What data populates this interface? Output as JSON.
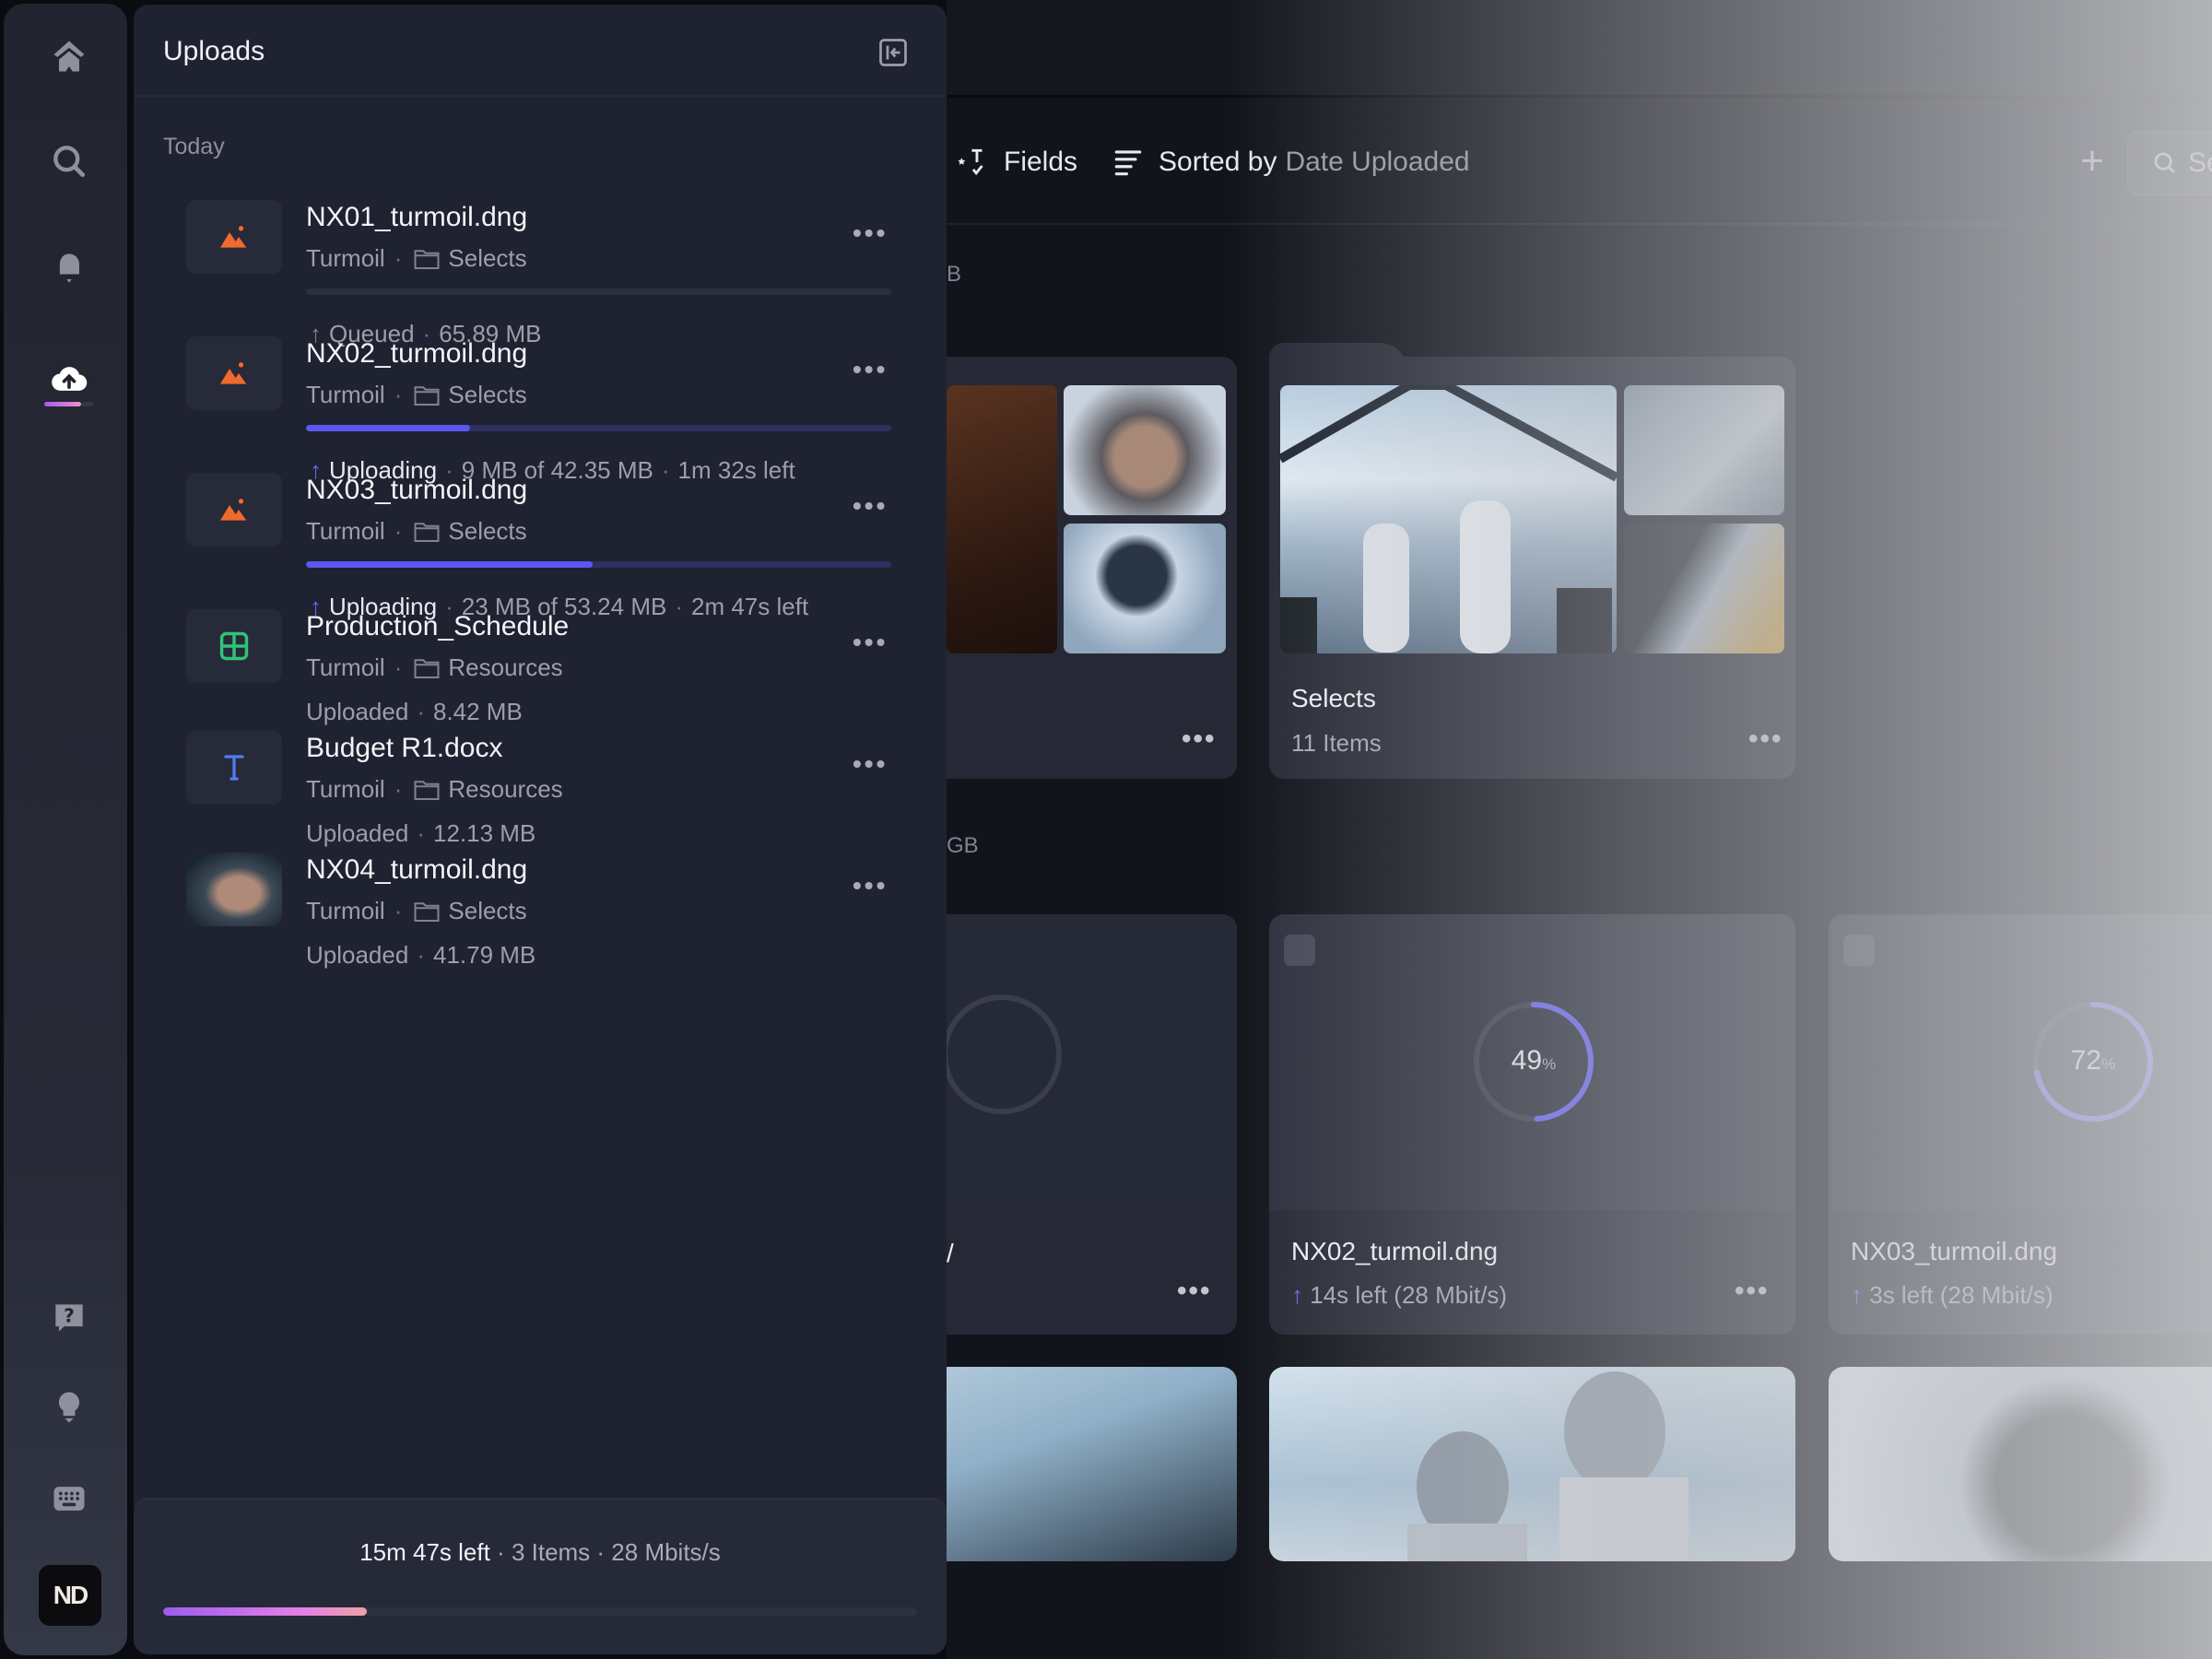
{
  "rail": {
    "items": [
      "home",
      "search",
      "notifications",
      "uploads"
    ],
    "bottom": [
      "help",
      "tips",
      "keyboard-shortcuts"
    ],
    "avatar_initials": "ND",
    "upload_progress": 0.74
  },
  "uploads": {
    "title": "Uploads",
    "group": "Today",
    "items": [
      {
        "name": "NX01_turmoil.dng",
        "project": "Turmoil",
        "folder": "Selects",
        "type": "image",
        "state": "Queued",
        "detail": "65.89 MB",
        "progress": 0
      },
      {
        "name": "NX02_turmoil.dng",
        "project": "Turmoil",
        "folder": "Selects",
        "type": "image",
        "state": "Uploading",
        "detail": "9 MB of 42.35 MB",
        "eta": "1m 32s left",
        "progress": 0.28
      },
      {
        "name": "NX03_turmoil.dng",
        "project": "Turmoil",
        "folder": "Selects",
        "type": "image",
        "state": "Uploading",
        "detail": "23 MB of 53.24 MB",
        "eta": "2m 47s left",
        "progress": 0.49
      },
      {
        "name": "Production_Schedule",
        "project": "Turmoil",
        "folder": "Resources",
        "type": "spreadsheet",
        "state": "Uploaded",
        "detail": "8.42 MB"
      },
      {
        "name": "Budget R1.docx",
        "project": "Turmoil",
        "folder": "Resources",
        "type": "document",
        "state": "Uploaded",
        "detail": "12.13 MB"
      },
      {
        "name": "NX04_turmoil.dng",
        "project": "Turmoil",
        "folder": "Selects",
        "type": "photo",
        "state": "Uploaded",
        "detail": "41.79 MB"
      }
    ],
    "footer": {
      "time_left": "15m 47s left",
      "items": "3 Items",
      "speed": "28 Mbits/s",
      "progress": 0.27
    }
  },
  "toolbar": {
    "fields": "Fields",
    "sorted_prefix": "Sorted by",
    "sorted_value": "Date Uploaded",
    "search_placeholder": "Se"
  },
  "main": {
    "group1_partial": "B",
    "group2_partial": "GB",
    "folder": {
      "name": "Selects",
      "count": "11 Items"
    },
    "uploading_cards": [
      {
        "name": "NX02_turmoil.dng",
        "status": "14s left (28 Mbit/s)",
        "percent": 49,
        "percent_label": "49"
      },
      {
        "name": "NX03_turmoil.dng",
        "status": "3s left (28 Mbit/s)",
        "percent": 72,
        "percent_label": "72"
      }
    ],
    "percent_sign": "%",
    "partial_card_letter": "/"
  },
  "colors": {
    "accent": "#5b57f2",
    "image_icon": "#ef6a2c",
    "sheet_icon": "#2fc47a",
    "doc_icon": "#4f7cf2"
  }
}
